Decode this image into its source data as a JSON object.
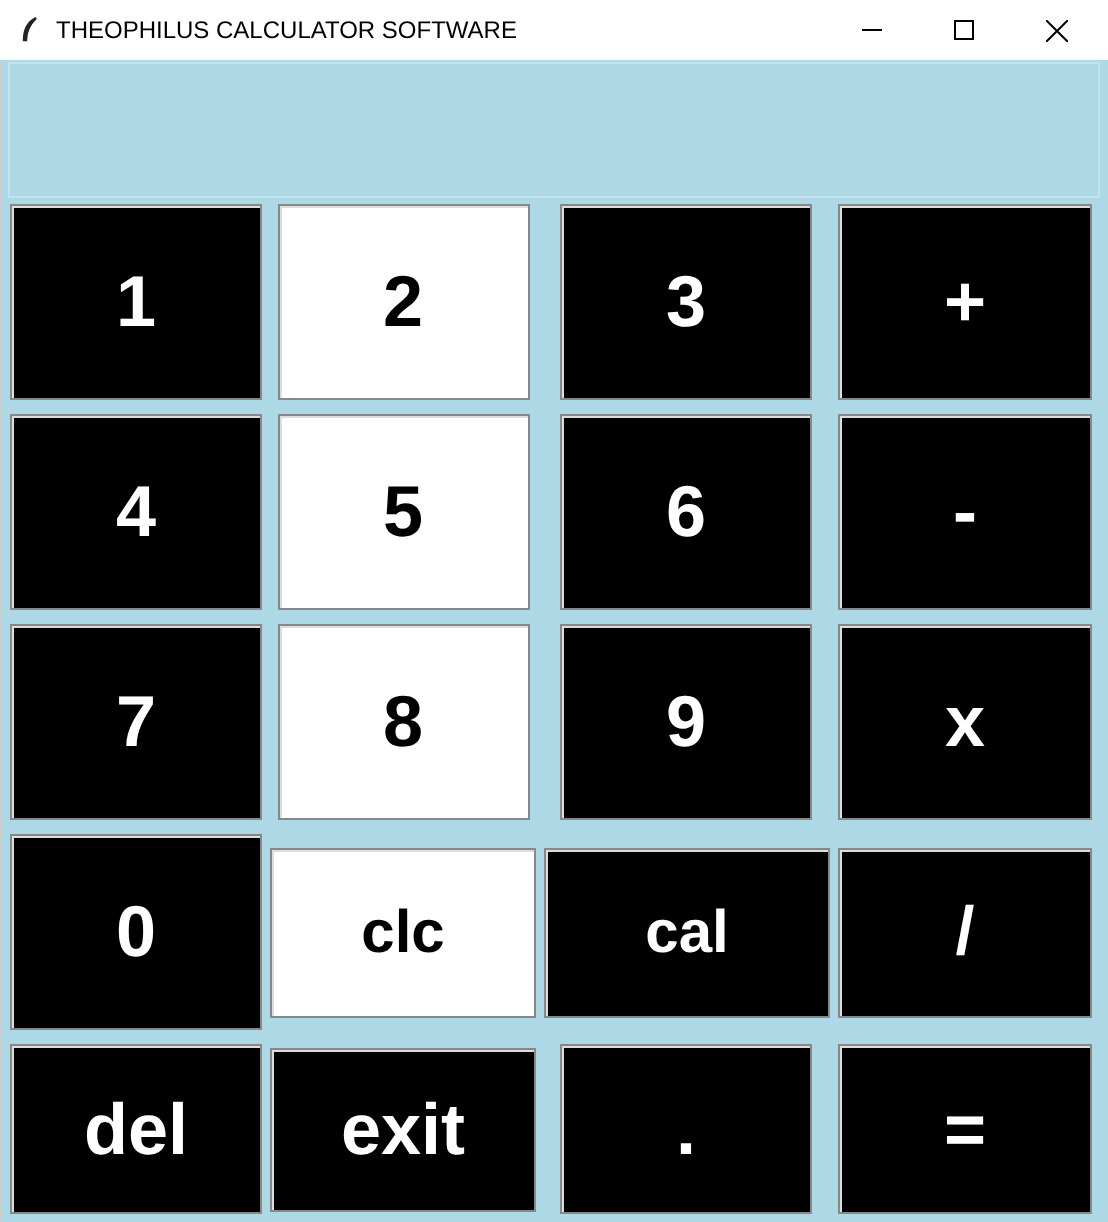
{
  "window": {
    "title": "THEOPHILUS CALCULATOR SOFTWARE"
  },
  "keys": [
    {
      "label": "1",
      "kind": "dark"
    },
    {
      "label": "2",
      "kind": "light"
    },
    {
      "label": "3",
      "kind": "dark"
    },
    {
      "label": "+",
      "kind": "dark"
    },
    {
      "label": "4",
      "kind": "dark"
    },
    {
      "label": "5",
      "kind": "light"
    },
    {
      "label": "6",
      "kind": "dark"
    },
    {
      "label": "-",
      "kind": "dark"
    },
    {
      "label": "7",
      "kind": "dark"
    },
    {
      "label": "8",
      "kind": "light"
    },
    {
      "label": "9",
      "kind": "dark"
    },
    {
      "label": "x",
      "kind": "dark"
    },
    {
      "label": "0",
      "kind": "dark"
    },
    {
      "label": "clc",
      "kind": "light"
    },
    {
      "label": "cal",
      "kind": "dark"
    },
    {
      "label": "/",
      "kind": "dark"
    },
    {
      "label": "del",
      "kind": "dark"
    },
    {
      "label": "exit",
      "kind": "dark"
    },
    {
      "label": ".",
      "kind": "dark"
    },
    {
      "label": "=",
      "kind": "dark"
    }
  ]
}
